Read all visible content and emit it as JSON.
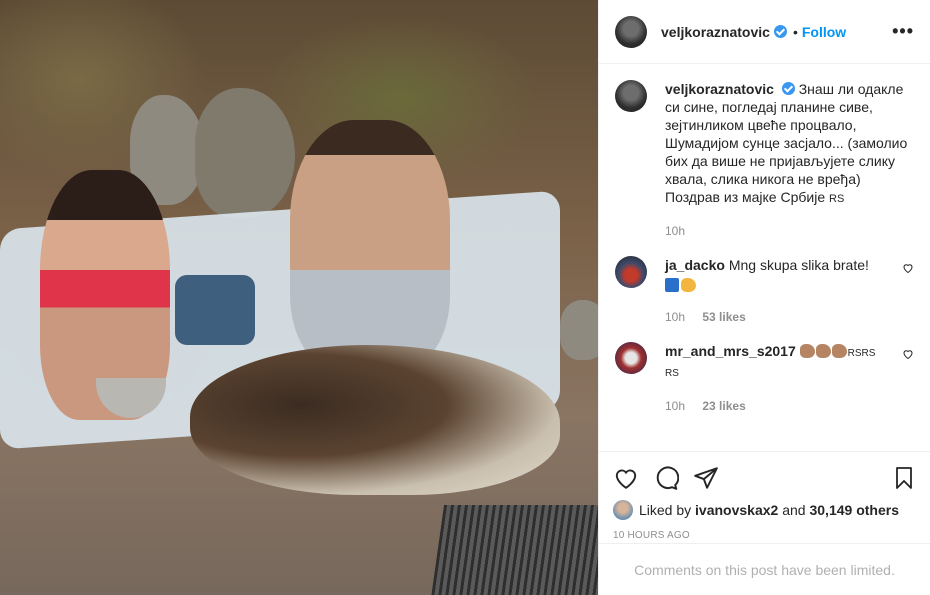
{
  "post": {
    "author": {
      "username": "veljkoraznatovic",
      "verified": true
    },
    "header": {
      "separator": "•",
      "follow_label": "Follow",
      "more_label": "•••"
    },
    "caption": {
      "username": "veljkoraznatovic",
      "text": "Знаш ли одакле\nси сине, погледај планине сиве,\nзејтинликом цвеће процвало,\nШумадијом сунце засјало... (замолио\nбих да више не пријављујете слику\nхвала, слика никога не вређа)\nПоздрав из мајке Србије",
      "suffix": "RS",
      "time": "10h"
    },
    "comments": [
      {
        "username": "ja_dacko",
        "text": "Mng skupa slika brate!",
        "time": "10h",
        "likes": "53 likes"
      },
      {
        "username": "mr_and_mrs_s2017",
        "suffix1": "RSRS",
        "suffix2": "RS",
        "time": "10h",
        "likes": "23 likes"
      }
    ],
    "likes": {
      "prefix": "Liked by",
      "user": "ivanovskax2",
      "and": "and",
      "count": "30,149 others"
    },
    "timestamp": "10 HOURS AGO",
    "limited_notice": "Comments on this post have been limited."
  },
  "colors": {
    "accent": "#0095f6",
    "verified": "#3897f0",
    "muted": "#8e8e8e"
  },
  "icons": [
    "like-icon",
    "comment-icon",
    "share-icon",
    "save-icon",
    "verified-icon",
    "more-icon"
  ]
}
